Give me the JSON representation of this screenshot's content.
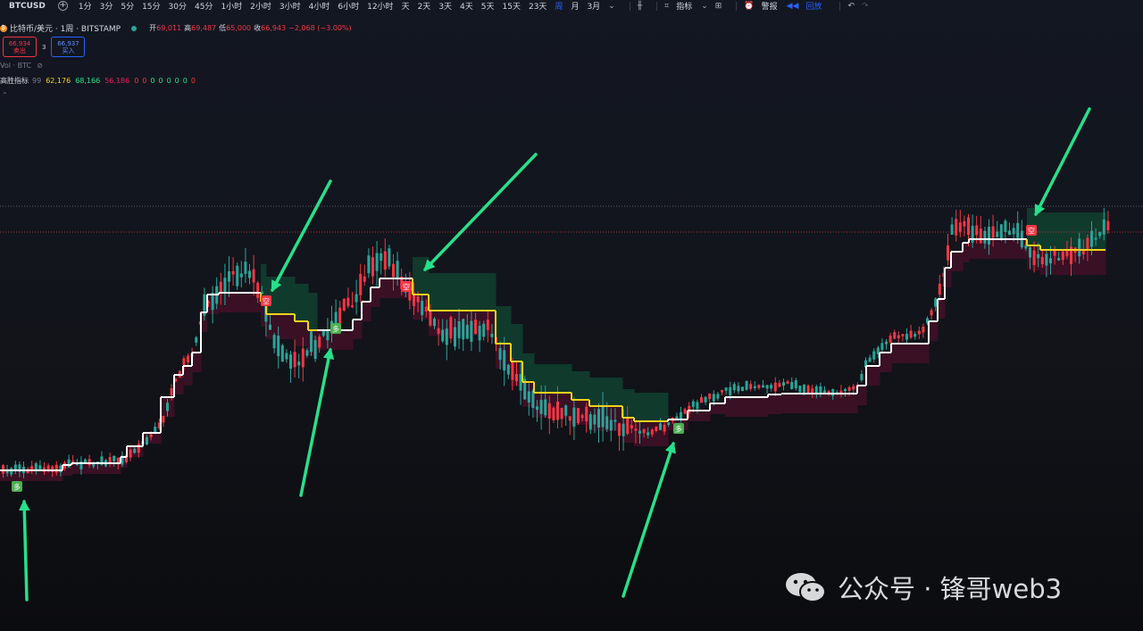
{
  "toolbar": {
    "symbol": "BTCUSD",
    "add_symbol_icon": "plus-circle-icon",
    "intervals": [
      "1分",
      "3分",
      "5分",
      "15分",
      "30分",
      "45分",
      "1小时",
      "2小时",
      "3小时",
      "4小时",
      "6小时",
      "12小时",
      "天",
      "2天",
      "3天",
      "4天",
      "5天",
      "15天",
      "23天",
      "周",
      "月",
      "3月"
    ],
    "active_interval": "周",
    "indicators_label": "指标",
    "alert_label": "警报",
    "replay_label": "回放"
  },
  "legend": {
    "title": "比特币/美元 · 1周 · BITSTAMP",
    "open_label": "开",
    "open": "69,011",
    "high_label": "高",
    "high": "69,487",
    "low_label": "低",
    "low": "65,000",
    "close_label": "收",
    "close": "66,943",
    "change": "−2,068 (−3.00%)"
  },
  "trade": {
    "sell_price": "66,934",
    "sell_label": "卖出",
    "spread": "3",
    "buy_price": "66,937",
    "buy_label": "买入"
  },
  "volume": {
    "label": "Vol · BTC"
  },
  "indicator": {
    "name": "高胜指标",
    "period": "99",
    "v1": "62,176",
    "v2": "68,166",
    "v3": "56,186",
    "zeros": [
      "0",
      "0",
      "0",
      "0",
      "0",
      "0",
      "0",
      "0"
    ]
  },
  "signals": {
    "buy_text": "多",
    "sell_text": "空"
  },
  "watermark": {
    "text": "公众号 · 锋哥web3"
  },
  "colors": {
    "bg": "#131722",
    "up": "#26a69a",
    "down": "#f23645",
    "trend_up": "#ffffff",
    "trend_down": "#f5d11b",
    "arrow": "#27e08a",
    "cloud_bull": "#0f3a2c",
    "cloud_bear": "#3a1024"
  }
}
